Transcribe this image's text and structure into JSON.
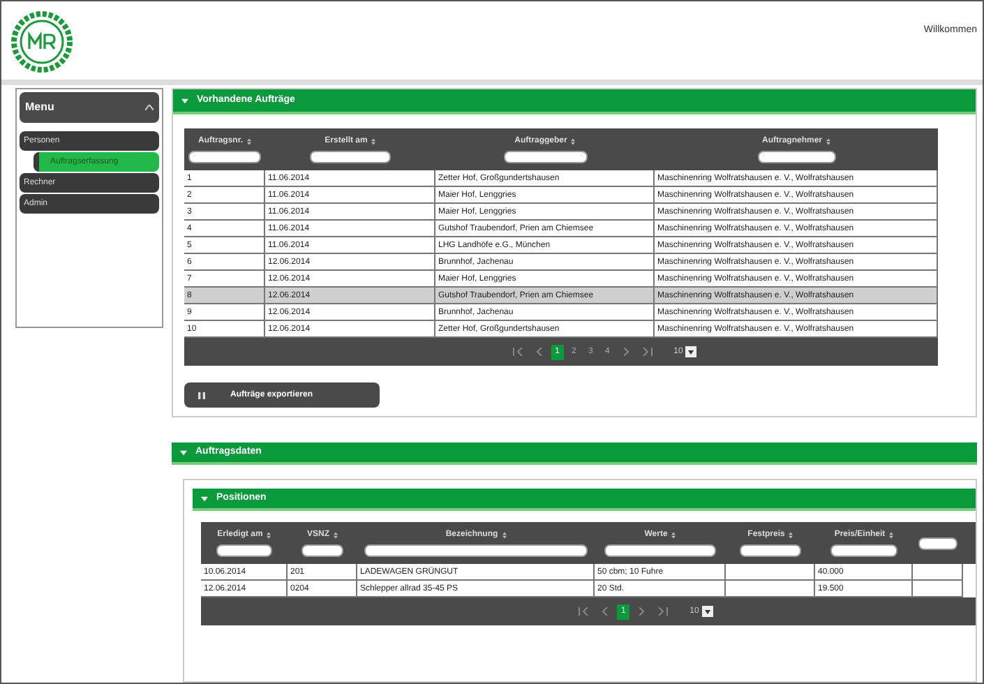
{
  "header": {
    "greeting": "Willkommen"
  },
  "menu": {
    "title": "Menu",
    "items": [
      {
        "label": "Personen",
        "selected": false,
        "children": [
          {
            "label": "Auftragserfassung",
            "selected": true
          }
        ]
      },
      {
        "label": "Rechner",
        "selected": false
      },
      {
        "label": "Admin",
        "selected": false
      }
    ]
  },
  "orders_panel": {
    "title": "Vorhandene Aufträge",
    "expanded": true,
    "table": {
      "columns": [
        "Auftragsnr.",
        "Erstellt am",
        "Auftraggeber",
        "Auftragnehmer"
      ],
      "rows": [
        {
          "cells": [
            "1",
            "11.06.2014",
            "Zetter Hof, Großgundertshausen",
            "Maschinenring Wolfratshausen e. V., Wolfratshausen"
          ],
          "selected": false
        },
        {
          "cells": [
            "2",
            "11.06.2014",
            "Maier Hof, Lenggries",
            "Maschinenring Wolfratshausen e. V., Wolfratshausen"
          ],
          "selected": false
        },
        {
          "cells": [
            "3",
            "11.06.2014",
            "Maier Hof, Lenggries",
            "Maschinenring Wolfratshausen e. V., Wolfratshausen"
          ],
          "selected": false
        },
        {
          "cells": [
            "4",
            "11.06.2014",
            "Gutshof Traubendorf, Prien am Chiemsee",
            "Maschinenring Wolfratshausen e. V., Wolfratshausen"
          ],
          "selected": false
        },
        {
          "cells": [
            "5",
            "11.06.2014",
            "LHG Landhöfe e.G., München",
            "Maschinenring Wolfratshausen e. V., Wolfratshausen"
          ],
          "selected": false
        },
        {
          "cells": [
            "6",
            "12.06.2014",
            "Brunnhof, Jachenau",
            "Maschinenring Wolfratshausen e. V., Wolfratshausen"
          ],
          "selected": false
        },
        {
          "cells": [
            "7",
            "12.06.2014",
            "Maier Hof, Lenggries",
            "Maschinenring Wolfratshausen e. V., Wolfratshausen"
          ],
          "selected": false
        },
        {
          "cells": [
            "8",
            "12.06.2014",
            "Gutshof Traubendorf, Prien am Chiemsee",
            "Maschinenring Wolfratshausen e. V., Wolfratshausen"
          ],
          "selected": true
        },
        {
          "cells": [
            "9",
            "12.06.2014",
            "Brunnhof, Jachenau",
            "Maschinenring Wolfratshausen e. V., Wolfratshausen"
          ],
          "selected": false
        },
        {
          "cells": [
            "10",
            "12.06.2014",
            "Zetter Hof, Großgundertshausen",
            "Maschinenring Wolfratshausen e. V., Wolfratshausen"
          ],
          "selected": false
        }
      ]
    },
    "pager": {
      "pages": [
        {
          "label": "1",
          "selected": true
        },
        {
          "label": "2",
          "selected": false
        },
        {
          "label": "3",
          "selected": false
        },
        {
          "label": "4",
          "selected": false
        }
      ],
      "page_size": "10"
    }
  },
  "export_button": {
    "label": "Aufträge exportieren"
  },
  "order_data_panel": {
    "title": "Auftragsdaten",
    "expanded": true
  },
  "positions_panel": {
    "title": "Positionen",
    "expanded": true,
    "table": {
      "columns": [
        {
          "label": "Erledigt am"
        },
        {
          "label": "VSNZ"
        },
        {
          "label": "Bezeichnung"
        },
        {
          "label": "Werte"
        },
        {
          "label": "Festpreis"
        },
        {
          "label": "Preis/Einheit"
        },
        {}
      ],
      "rows": [
        {
          "cells": [
            "10.06.2014",
            "201",
            "LADEWAGEN GRÜNGUT",
            "50 cbm; 10 Fuhre",
            "",
            "40.000",
            ""
          ],
          "selected": false
        },
        {
          "cells": [
            "12.06.2014",
            "0204",
            "Schlepper allrad 35-45 PS",
            "20 Std.",
            "",
            "19.500",
            ""
          ],
          "selected": false
        }
      ]
    },
    "pager": {
      "pages": [
        {
          "label": "1",
          "selected": true
        }
      ],
      "page_size": "10"
    }
  }
}
